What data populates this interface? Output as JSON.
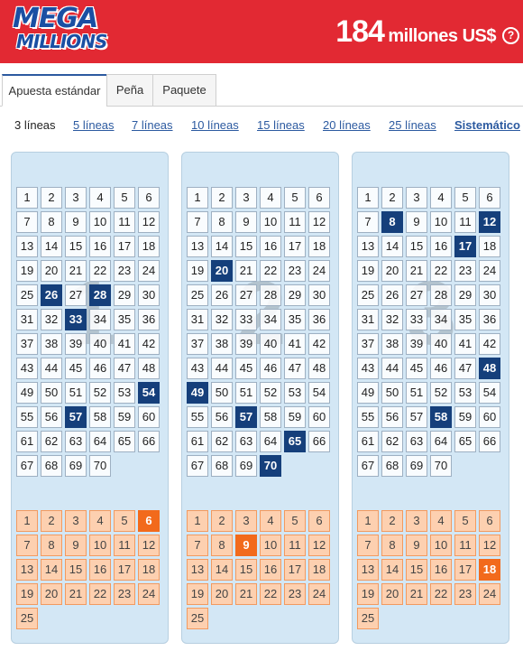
{
  "header": {
    "logo_line1": "MEGA",
    "logo_line2": "MILLIONS",
    "jackpot_amount": "184",
    "jackpot_unit": "millones US$",
    "help_label": "?",
    "brand_color": "#e22933"
  },
  "tabs": [
    {
      "label": "Apuesta estándar",
      "active": true
    },
    {
      "label": "Peña",
      "active": false
    },
    {
      "label": "Paquete",
      "active": false
    }
  ],
  "line_options": [
    {
      "label": "3 líneas",
      "selected": true
    },
    {
      "label": "5 líneas",
      "selected": false
    },
    {
      "label": "7 líneas",
      "selected": false
    },
    {
      "label": "10 líneas",
      "selected": false
    },
    {
      "label": "15 líneas",
      "selected": false
    },
    {
      "label": "20 líneas",
      "selected": false
    },
    {
      "label": "25 líneas",
      "selected": false
    },
    {
      "label": "Sistemático",
      "selected": false
    }
  ],
  "main_number_max": 70,
  "mega_ball_max": 25,
  "lines": [
    {
      "label": "1",
      "selected_main": [
        26,
        28,
        33,
        54,
        57
      ],
      "selected_mega": [
        6
      ]
    },
    {
      "label": "2",
      "selected_main": [
        20,
        49,
        57,
        65,
        70
      ],
      "selected_mega": [
        9
      ]
    },
    {
      "label": "3",
      "selected_main": [
        8,
        12,
        17,
        48,
        58
      ],
      "selected_mega": [
        18
      ]
    }
  ],
  "colors": {
    "selected_main": "#153f7b",
    "selected_mega": "#f26a1c",
    "panel_bg": "#d3e7f5"
  }
}
